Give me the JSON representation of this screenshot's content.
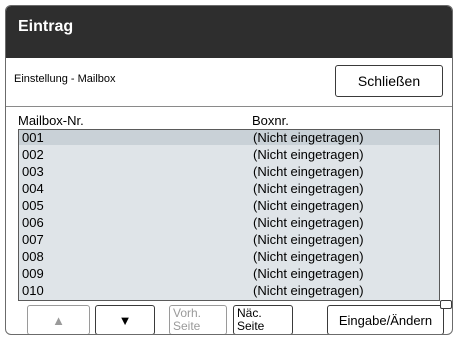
{
  "window": {
    "title": "Eintrag"
  },
  "header": {
    "subtitle": "Einstellung - Mailbox",
    "close_label": "Schließen"
  },
  "columns": {
    "mailbox_no": "Mailbox-Nr.",
    "box_no": "Boxnr."
  },
  "rows": [
    {
      "no": "001",
      "status": "(Nicht eingetragen)"
    },
    {
      "no": "002",
      "status": "(Nicht eingetragen)"
    },
    {
      "no": "003",
      "status": "(Nicht eingetragen)"
    },
    {
      "no": "004",
      "status": "(Nicht eingetragen)"
    },
    {
      "no": "005",
      "status": "(Nicht eingetragen)"
    },
    {
      "no": "006",
      "status": "(Nicht eingetragen)"
    },
    {
      "no": "007",
      "status": "(Nicht eingetragen)"
    },
    {
      "no": "008",
      "status": "(Nicht eingetragen)"
    },
    {
      "no": "009",
      "status": "(Nicht eingetragen)"
    },
    {
      "no": "010",
      "status": "(Nicht eingetragen)"
    }
  ],
  "buttons": {
    "up_icon": "triangle-up-icon",
    "down_icon": "triangle-down-icon",
    "prev_line1": "Vorh.",
    "prev_line2": "Seite",
    "next_line1": "Näc.",
    "next_line2": "Seite",
    "enter_change": "Eingabe/Ändern"
  },
  "colors": {
    "titlebar": "#2e2e2e",
    "list_bg": "#dfe4e8",
    "selected_row": "#c9d1d7",
    "disabled": "#9a9a9a"
  }
}
